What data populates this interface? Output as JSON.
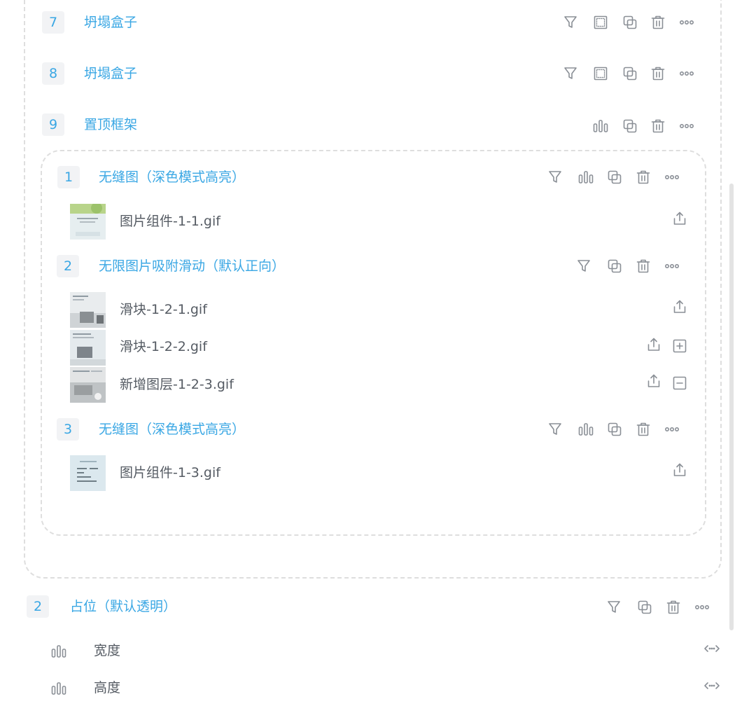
{
  "groups": [
    {
      "index": "7",
      "title": "坍塌盒子",
      "actions": [
        "filter-icon",
        "dotted-square-icon",
        "copy-icon",
        "trash-icon",
        "more-icon"
      ]
    },
    {
      "index": "8",
      "title": "坍塌盒子",
      "actions": [
        "filter-icon",
        "dotted-square-icon",
        "copy-icon",
        "trash-icon",
        "more-icon"
      ]
    },
    {
      "index": "9",
      "title": "置顶框架",
      "actions": [
        "bars-icon",
        "copy-icon",
        "trash-icon",
        "more-icon"
      ]
    }
  ],
  "frame_children": [
    {
      "index": "1",
      "title": "无缝图（深色模式高亮）",
      "actions": [
        "filter-icon",
        "bars-icon",
        "copy-icon",
        "trash-icon",
        "more-icon"
      ],
      "items": [
        {
          "label": "图片组件-1-1.gif",
          "actions": [
            "upload-icon"
          ]
        }
      ]
    },
    {
      "index": "2",
      "title": "无限图片吸附滑动（默认正向）",
      "actions": [
        "filter-icon",
        "copy-icon",
        "trash-icon",
        "more-icon"
      ],
      "items": [
        {
          "label": "滑块-1-2-1.gif",
          "actions": [
            "upload-icon"
          ]
        },
        {
          "label": "滑块-1-2-2.gif",
          "actions": [
            "upload-icon",
            "plus-square-icon"
          ]
        },
        {
          "label": "新增图层-1-2-3.gif",
          "actions": [
            "upload-icon",
            "minus-square-icon"
          ]
        }
      ]
    },
    {
      "index": "3",
      "title": "无缝图（深色模式高亮）",
      "actions": [
        "filter-icon",
        "bars-icon",
        "copy-icon",
        "trash-icon",
        "more-icon"
      ],
      "items": [
        {
          "label": "图片组件-1-3.gif",
          "actions": [
            "upload-icon"
          ]
        }
      ]
    }
  ],
  "placeholder_group": {
    "index": "2",
    "title": "占位（默认透明）",
    "actions": [
      "filter-icon",
      "copy-icon",
      "trash-icon",
      "more-icon"
    ],
    "properties": [
      {
        "label": "宽度",
        "icon": "bars-icon",
        "action": "resize-horizontal-icon"
      },
      {
        "label": "高度",
        "icon": "bars-icon",
        "action": "resize-horizontal-icon"
      }
    ]
  },
  "colors": {
    "accent": "#3aa7e4",
    "icon": "#8a8f96",
    "label": "#555b63",
    "badge_bg": "#f2f3f5",
    "frame_border": "#dedede"
  }
}
